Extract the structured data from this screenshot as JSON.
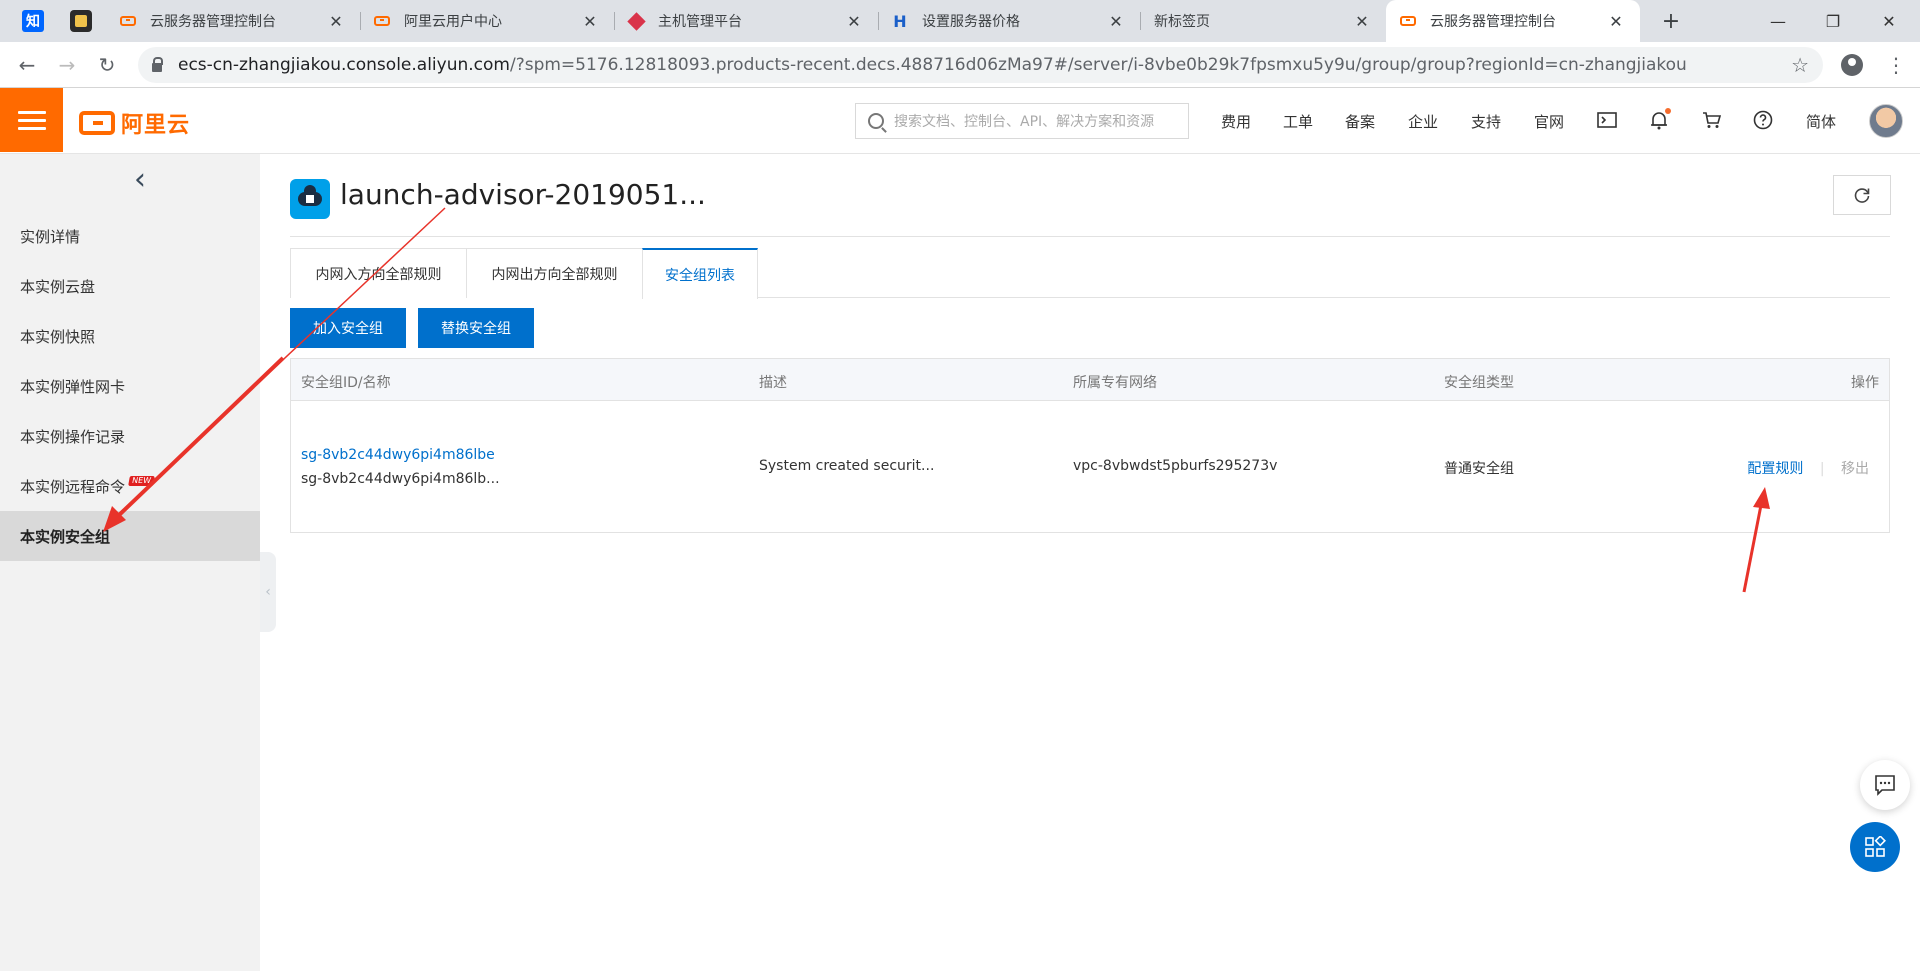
{
  "browser": {
    "tabs": [
      {
        "title": "云服务器管理控制台",
        "favicon": "aliyun-icon"
      },
      {
        "title": "阿里云用户中心",
        "favicon": "aliyun-icon"
      },
      {
        "title": "主机管理平台",
        "favicon": "diamond-icon"
      },
      {
        "title": "设置服务器价格",
        "favicon": "h-icon"
      },
      {
        "title": "新标签页",
        "favicon": ""
      },
      {
        "title": "云服务器管理控制台",
        "favicon": "aliyun-icon",
        "active": true
      }
    ],
    "pinned_tabs": [
      {
        "glyph": "知",
        "name": "zhihu"
      },
      {
        "name": "app"
      }
    ],
    "url_host": "ecs-cn-zhangjiakou.console.aliyun.com",
    "url_rest": "/?spm=5176.12818093.products-recent.decs.488716d06zMa97#/server/i-8vbe0b29k7fpsmxu5y9u/group/group?regionId=cn-zhangjiakou"
  },
  "header": {
    "logo_text": "阿里云",
    "search_placeholder": "搜索文档、控制台、API、解决方案和资源",
    "nav": [
      "费用",
      "工单",
      "备案",
      "企业",
      "支持",
      "官网"
    ],
    "lang": "简体"
  },
  "sidebar": {
    "items": [
      {
        "label": "实例详情"
      },
      {
        "label": "本实例云盘"
      },
      {
        "label": "本实例快照"
      },
      {
        "label": "本实例弹性网卡"
      },
      {
        "label": "本实例操作记录"
      },
      {
        "label": "本实例远程命令",
        "badge": "NEW"
      },
      {
        "label": "本实例安全组",
        "active": true
      }
    ]
  },
  "main": {
    "title": "launch-advisor-2019051...",
    "tabs": [
      "内网入方向全部规则",
      "内网出方向全部规则",
      "安全组列表"
    ],
    "active_tab": 2,
    "buttons": {
      "add": "加入安全组",
      "replace": "替换安全组"
    },
    "table": {
      "headers": [
        "安全组ID/名称",
        "描述",
        "所属专有网络",
        "安全组类型",
        "操作"
      ],
      "rows": [
        {
          "id": "sg-8vb2c44dwy6pi4m86lbe",
          "name": "sg-8vb2c44dwy6pi4m86lb...",
          "description": "System created securit...",
          "vpc": "vpc-8vbwdst5pburfs295273v",
          "type": "普通安全组",
          "action_config": "配置规则",
          "action_sep": "|",
          "action_remove": "移出"
        }
      ]
    }
  },
  "colors": {
    "brand_orange": "#ff6a00",
    "primary_blue": "#0070cc",
    "annotation_red": "#e8332a"
  }
}
